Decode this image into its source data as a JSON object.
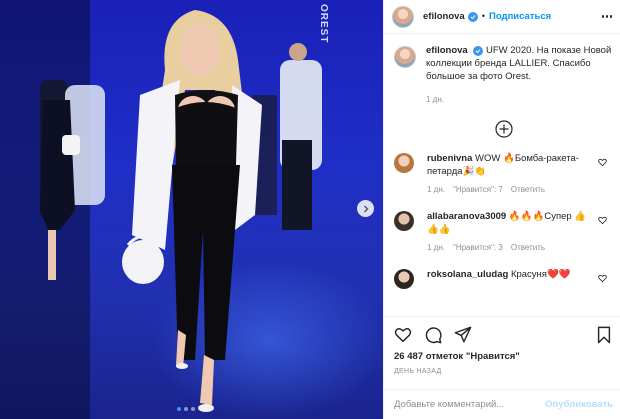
{
  "post": {
    "username": "efilonova",
    "follow_label": "Подписаться",
    "watermark": "OREST",
    "caption": "UFW 2020. На показе Новой коллекции бренда LALLIER. Спасибо большое за фото Orest.",
    "caption_time": "1 дн.",
    "likes_text": "26 487 отметок \"Нравится\"",
    "posted_ago": "ДЕНЬ НАЗАД",
    "comment_placeholder": "Добавьте комментарий...",
    "publish_label": "Опубликовать"
  },
  "comments": [
    {
      "user": "rubenivna",
      "text": "WOW 🔥Бомба-ракета-петарда🎉👏",
      "time": "1 дн.",
      "likes": "\"Нравится\": 7",
      "reply": "Ответить"
    },
    {
      "user": "allabaranova3009",
      "text": "🔥🔥🔥Супер 👍👍👍",
      "time": "1 дн.",
      "likes": "\"Нравится\": 3",
      "reply": "Ответить"
    },
    {
      "user": "roksolana_uludag",
      "text": "Красуня❤️❤️",
      "time": "",
      "likes": "",
      "reply": ""
    }
  ],
  "carousel": {
    "total": 3,
    "active": 1
  },
  "colors": {
    "accent": "#0095f6",
    "verified": "#3897f0",
    "publish_disabled": "#b2dffc",
    "muted": "#8e8e8e"
  }
}
